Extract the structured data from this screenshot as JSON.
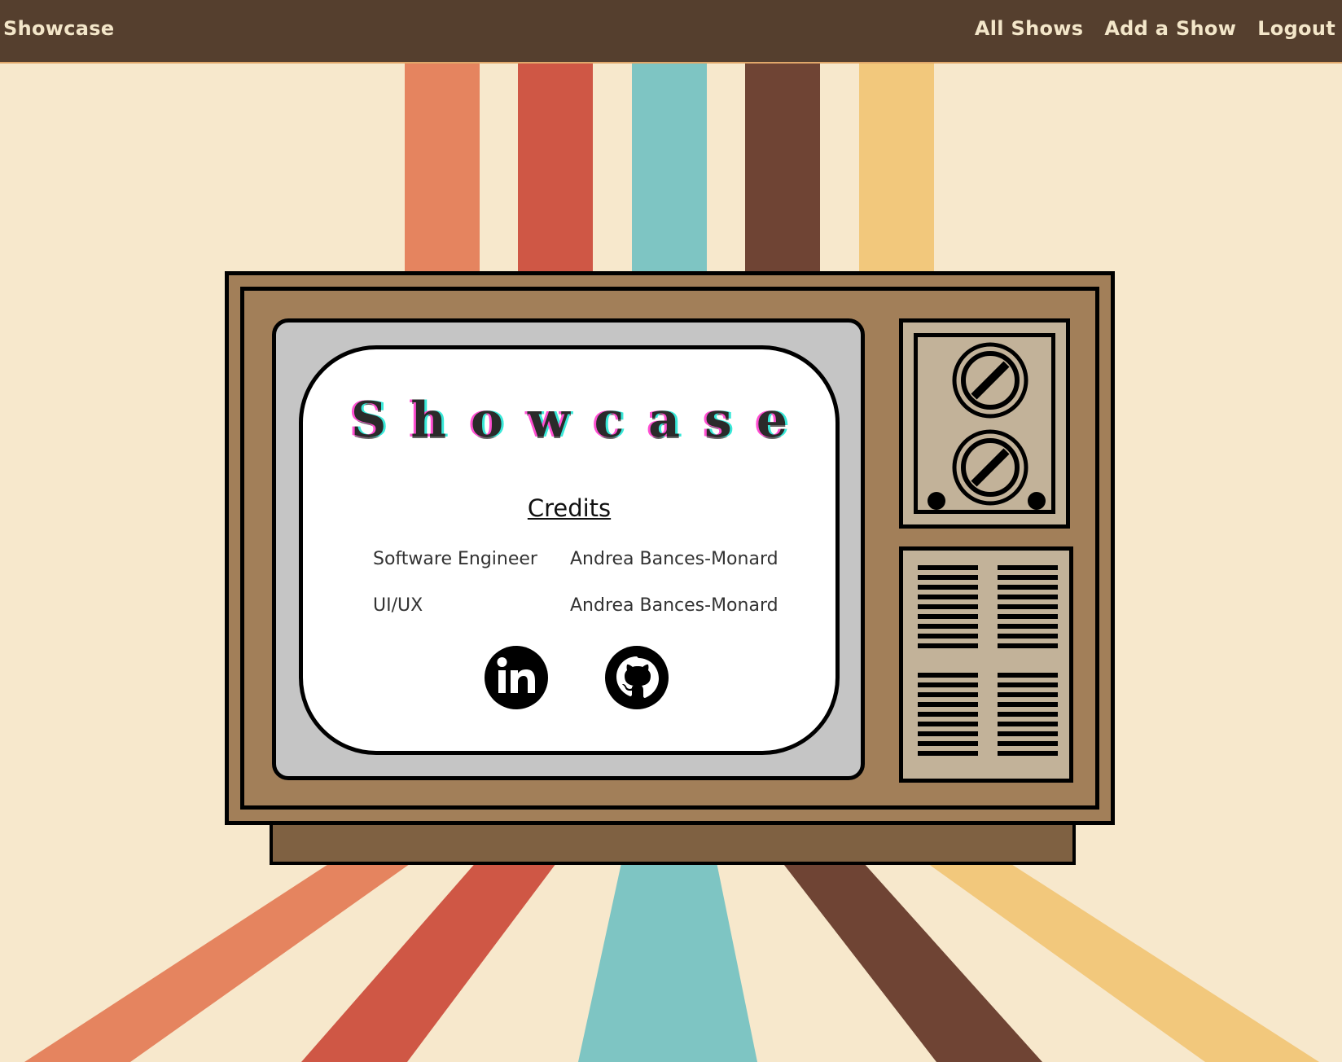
{
  "navbar": {
    "brand": "Showcase",
    "links": [
      "All Shows",
      "Add a Show",
      "Logout"
    ]
  },
  "screen": {
    "logo_text": "Showcase",
    "credits_heading": "Credits",
    "credits": [
      {
        "role": "Software Engineer",
        "name": "Andrea Bances-Monard"
      },
      {
        "role": "UI/UX",
        "name": "Andrea Bances-Monard"
      }
    ],
    "social_icons": [
      "linkedin-icon",
      "github-icon"
    ]
  },
  "colors": {
    "navbar": "#553f2e",
    "nav_text": "#f3e6c9",
    "background": "#f7e8cc",
    "tv_wood": "#a27f59",
    "stripes": [
      "#e5845f",
      "#cf5745",
      "#7ec5c3",
      "#6f4434",
      "#f2c87c"
    ]
  }
}
